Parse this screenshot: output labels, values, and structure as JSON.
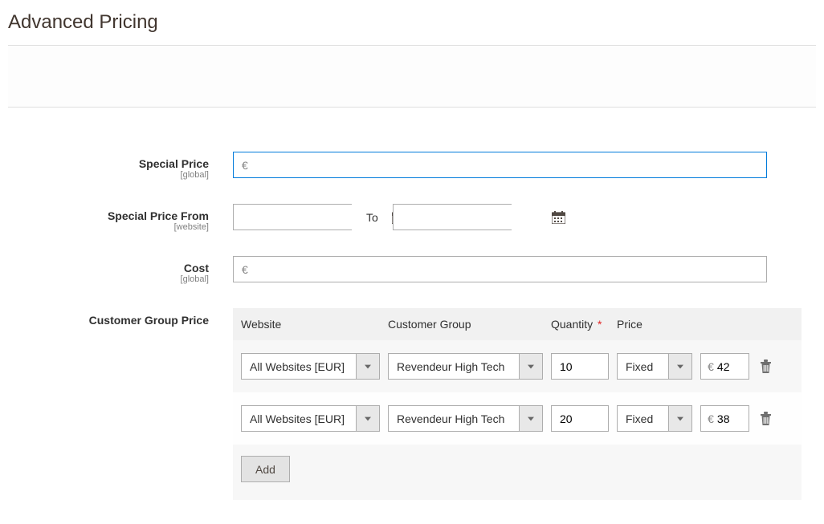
{
  "page_title": "Advanced Pricing",
  "fields": {
    "special_price": {
      "label": "Special Price",
      "scope": "[global]",
      "currency": "€",
      "value": ""
    },
    "special_price_from": {
      "label": "Special Price From",
      "scope": "[website]",
      "to_label": "To",
      "from_value": "",
      "to_value": ""
    },
    "cost": {
      "label": "Cost",
      "scope": "[global]",
      "currency": "€",
      "value": ""
    },
    "customer_group_price": {
      "label": "Customer Group Price"
    }
  },
  "group_price": {
    "headers": {
      "website": "Website",
      "customer_group": "Customer Group",
      "quantity": "Quantity",
      "price": "Price"
    },
    "required_mark": "*",
    "rows": [
      {
        "website": "All Websites [EUR]",
        "customer_group": "Revendeur High Tech",
        "quantity": "10",
        "price_type": "Fixed",
        "currency": "€",
        "price": "42"
      },
      {
        "website": "All Websites [EUR]",
        "customer_group": "Revendeur High Tech",
        "quantity": "20",
        "price_type": "Fixed",
        "currency": "€",
        "price": "38"
      }
    ],
    "add_button": "Add"
  }
}
